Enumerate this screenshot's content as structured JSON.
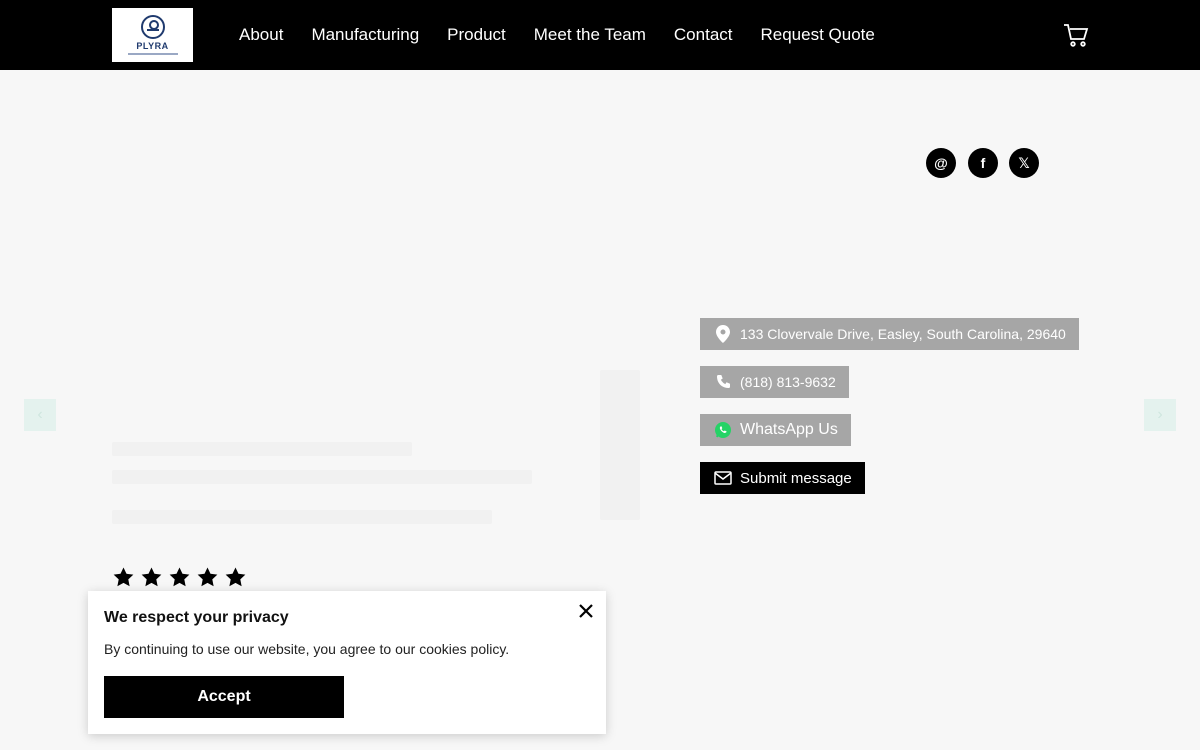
{
  "header": {
    "logo_text": "PLYRA",
    "nav": [
      "About",
      "Manufacturing",
      "Product",
      "Meet the Team",
      "Contact",
      "Request Quote"
    ],
    "cart_icon": "cart-icon"
  },
  "social": [
    {
      "name": "email-icon",
      "glyph": "@"
    },
    {
      "name": "facebook-icon",
      "glyph": "f"
    },
    {
      "name": "x-icon",
      "glyph": "𝕏"
    }
  ],
  "contact": {
    "address": "133 Clovervale Drive, Easley, South Carolina, 29640",
    "phone": "(818) 813-9632",
    "whatsapp": "WhatsApp Us",
    "submit": "Submit message"
  },
  "rating": {
    "stars": 5
  },
  "cookie": {
    "title": "We respect your privacy",
    "text": "By continuing to use our website, you agree to our cookies policy.",
    "accept": "Accept"
  },
  "colors": {
    "header_bg": "#000000",
    "button_gray": "#a6a6a6",
    "button_black": "#000000",
    "arrow_bg": "#e4f2ee"
  }
}
